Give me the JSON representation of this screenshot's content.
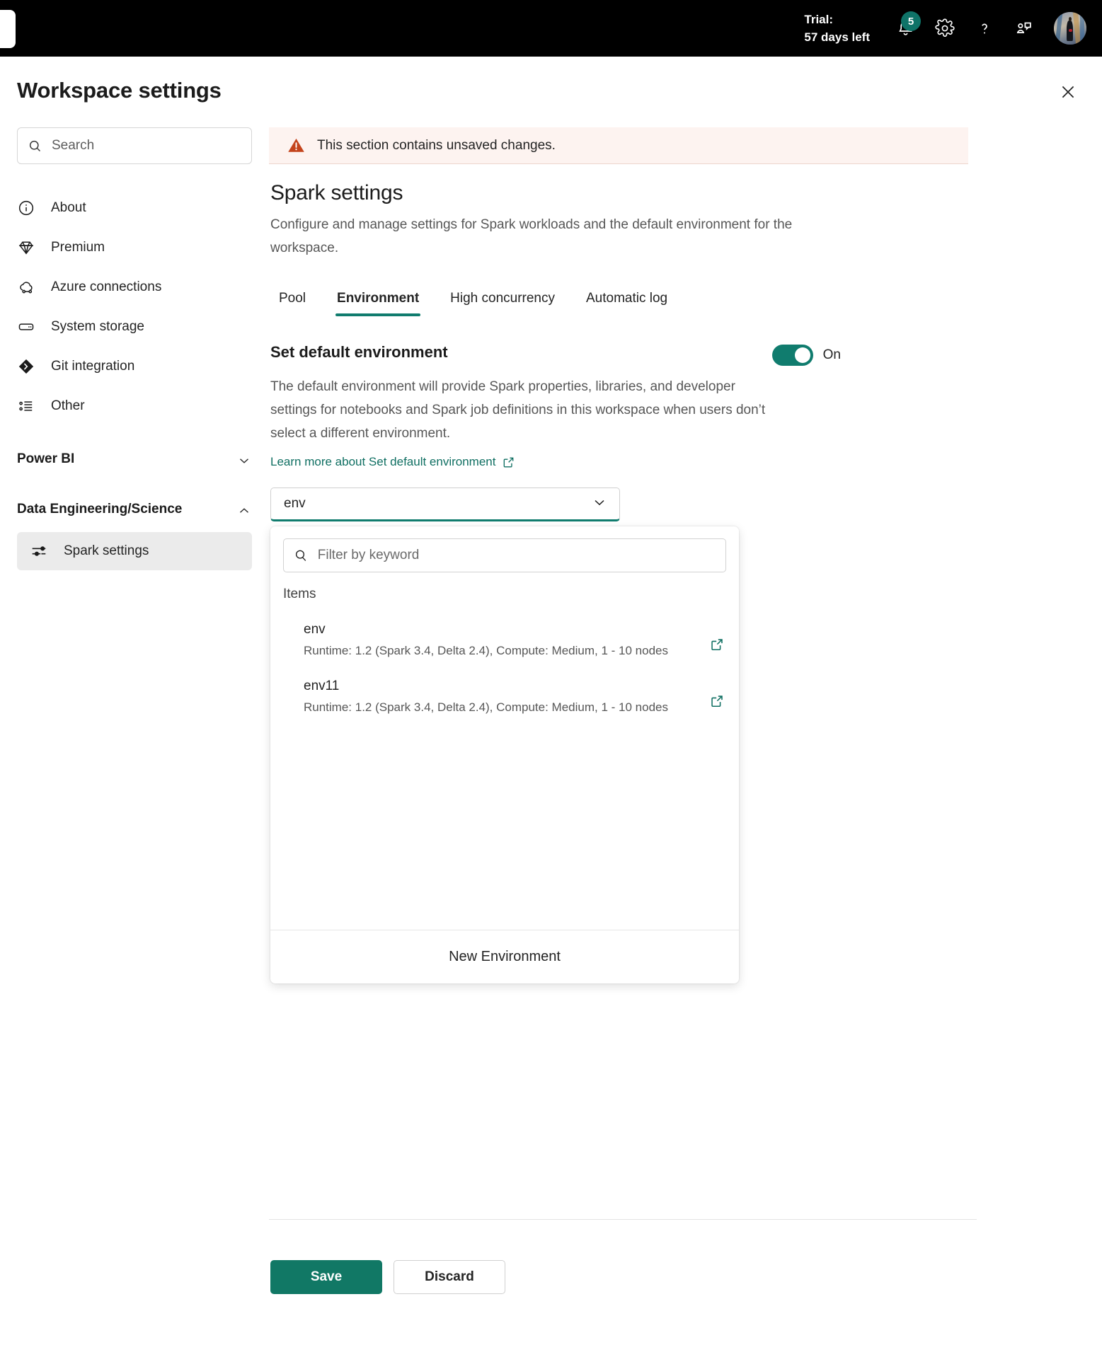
{
  "appbar": {
    "trial_label": "Trial:",
    "trial_days": "57 days left",
    "notifications_badge": "5",
    "icons": {
      "notifications": "bell-icon",
      "settings": "gear-icon",
      "help": "question-mark-icon",
      "feedback": "feedback-icon",
      "avatar": "user-avatar"
    },
    "accent_teal": "#0f7368"
  },
  "header": {
    "title": "Workspace settings",
    "close_label": "Close"
  },
  "sidebar": {
    "search_placeholder": "Search",
    "search_value": "",
    "items": [
      {
        "label": "About",
        "icon": "info-circle-icon"
      },
      {
        "label": "Premium",
        "icon": "diamond-icon"
      },
      {
        "label": "Azure connections",
        "icon": "cloud-link-icon"
      },
      {
        "label": "System storage",
        "icon": "storage-icon"
      },
      {
        "label": "Git integration",
        "icon": "git-icon"
      },
      {
        "label": "Other",
        "icon": "list-icon"
      }
    ],
    "groups": [
      {
        "title": "Power BI",
        "expanded": false,
        "chevron": "chevron-down-icon",
        "items": []
      },
      {
        "title": "Data Engineering/Science",
        "expanded": true,
        "chevron": "chevron-up-icon",
        "items": [
          {
            "label": "Spark settings",
            "icon": "sliders-icon",
            "active": true
          }
        ]
      }
    ]
  },
  "main": {
    "alert": {
      "text": "This section contains unsaved changes.",
      "icon": "warning-triangle-icon",
      "bg": "#fdf3f0",
      "icon_color": "#c4441c"
    },
    "section_title": "Spark settings",
    "section_desc": "Configure and manage settings for Spark workloads and the default environment for the workspace.",
    "tabs": [
      {
        "label": "Pool",
        "active": false
      },
      {
        "label": "Environment",
        "active": true
      },
      {
        "label": "High concurrency",
        "active": false
      },
      {
        "label": "Automatic log",
        "active": false
      }
    ],
    "tab_accent": "#107c6e",
    "setting": {
      "title": "Set default environment",
      "toggle_state": "On",
      "toggle_on": true,
      "toggle_color": "#107c6e",
      "description": "The default environment will provide Spark properties, libraries, and developer settings for notebooks and Spark job definitions in this workspace when users don’t select a different environment.",
      "learn_more": "Learn more about Set default environment",
      "learn_more_icon": "external-link-icon",
      "link_color": "#0f6f62"
    },
    "combobox": {
      "value": "env",
      "chevron": "chevron-down-icon",
      "focus_border": "#107c6e"
    },
    "dropdown": {
      "filter_placeholder": "Filter by keyword",
      "filter_value": "",
      "filter_icon": "search-icon",
      "group_label": "Items",
      "items": [
        {
          "name": "env",
          "detail": "Runtime: 1.2 (Spark 3.4, Delta 2.4), Compute: Medium, 1 - 10 nodes",
          "open_icon": "external-link-icon"
        },
        {
          "name": "env11",
          "detail": "Runtime: 1.2 (Spark 3.4, Delta 2.4), Compute: Medium, 1 - 10 nodes",
          "open_icon": "external-link-icon"
        }
      ],
      "footer_label": "New Environment"
    }
  },
  "footer": {
    "save_label": "Save",
    "discard_label": "Discard",
    "save_color": "#117865"
  }
}
